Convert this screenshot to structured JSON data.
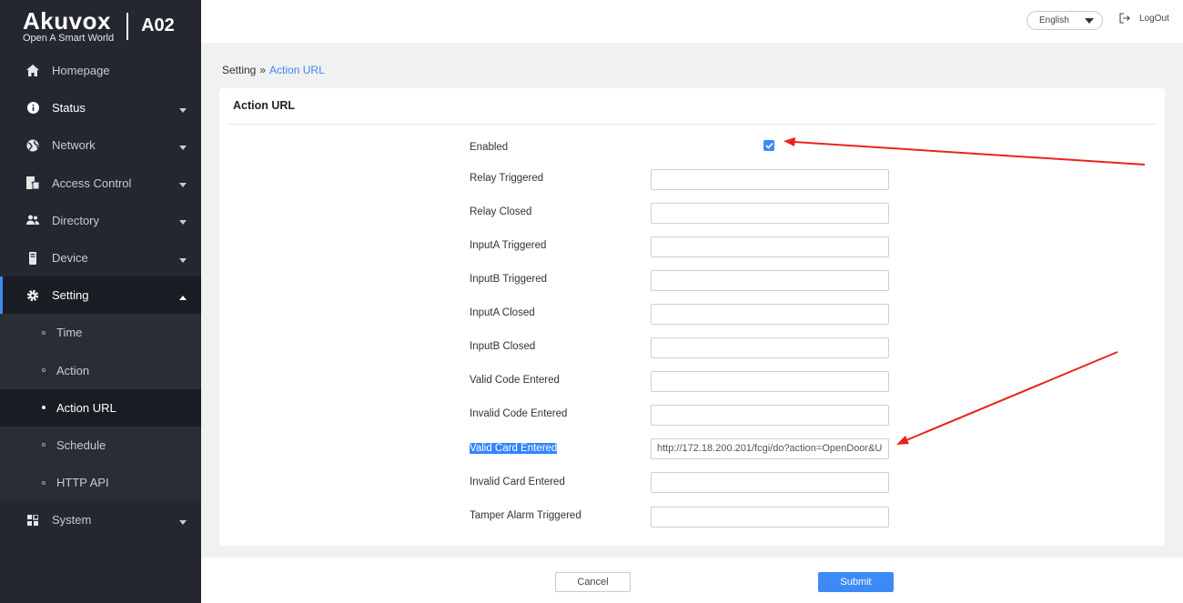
{
  "brand": {
    "name": "Akuvox",
    "tagline": "Open A Smart World",
    "model": "A02"
  },
  "topbar": {
    "language": "English",
    "logout": "LogOut"
  },
  "sidebar": {
    "items": [
      {
        "label": "Homepage",
        "icon": "home-icon"
      },
      {
        "label": "Status",
        "icon": "info-icon"
      },
      {
        "label": "Network",
        "icon": "globe-icon"
      },
      {
        "label": "Access Control",
        "icon": "door-icon"
      },
      {
        "label": "Directory",
        "icon": "users-icon"
      },
      {
        "label": "Device",
        "icon": "device-icon"
      },
      {
        "label": "Setting",
        "icon": "gear-icon"
      },
      {
        "label": "System",
        "icon": "grid-icon"
      }
    ],
    "setting_sub": [
      {
        "label": "Time"
      },
      {
        "label": "Action"
      },
      {
        "label": "Action URL"
      },
      {
        "label": "Schedule"
      },
      {
        "label": "HTTP API"
      }
    ]
  },
  "breadcrumb": {
    "parent": "Setting",
    "separator": "»",
    "current": "Action URL"
  },
  "card": {
    "title": "Action URL",
    "enabled_label": "Enabled",
    "enabled": true,
    "rows": [
      {
        "label": "Relay Triggered",
        "value": ""
      },
      {
        "label": "Relay Closed",
        "value": ""
      },
      {
        "label": "InputA Triggered",
        "value": ""
      },
      {
        "label": "InputB Triggered",
        "value": ""
      },
      {
        "label": "InputA Closed",
        "value": ""
      },
      {
        "label": "InputB Closed",
        "value": ""
      },
      {
        "label": "Valid Code Entered",
        "value": ""
      },
      {
        "label": "Invalid Code Entered",
        "value": ""
      },
      {
        "label": "Valid Card Entered",
        "value": "http://172.18.200.201/fcgi/do?action=OpenDoor&U"
      },
      {
        "label": "Invalid Card Entered",
        "value": ""
      },
      {
        "label": "Tamper Alarm Triggered",
        "value": ""
      }
    ]
  },
  "footer": {
    "cancel": "Cancel",
    "submit": "Submit"
  },
  "colors": {
    "accent": "#3d8af7",
    "sidebar_bg": "#24272f",
    "annotation": "#e8241c"
  }
}
